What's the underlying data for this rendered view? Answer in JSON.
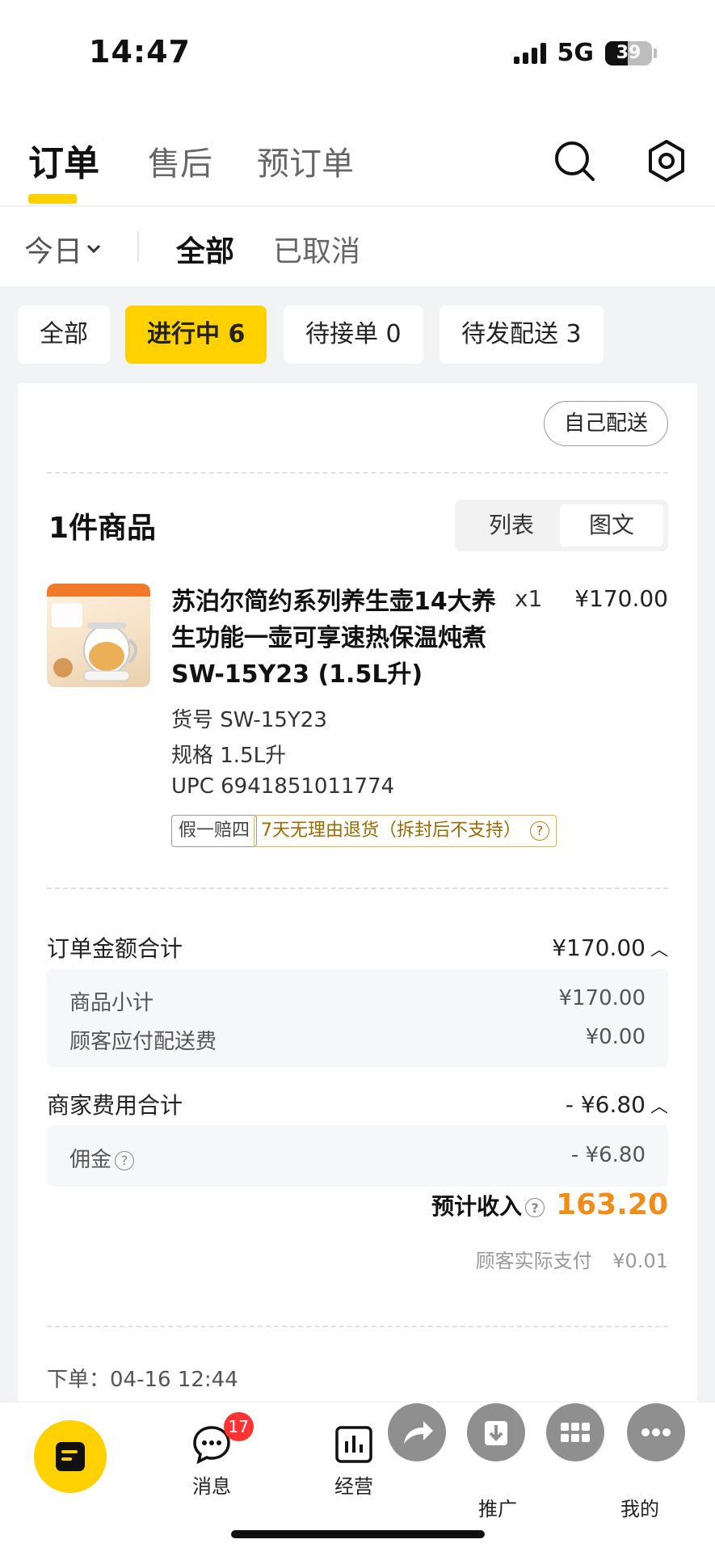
{
  "status_bar": {
    "time": "14:47",
    "network": "5G",
    "battery": "39"
  },
  "top_tabs": [
    "订单",
    "售后",
    "预订单"
  ],
  "filter": {
    "date": "今日",
    "segments": [
      "全部",
      "已取消"
    ]
  },
  "chips": [
    "全部",
    "进行中 6",
    "待接单 0",
    "待发配送 3"
  ],
  "card": {
    "self_delivery": "自己配送",
    "items_title": "1件商品",
    "view_toggle": [
      "列表",
      "图文"
    ],
    "product": {
      "name": "苏泊尔简约系列养生壶14大养生功能一壶可享速热保温炖煮SW-15Y23 (1.5L升)",
      "qty": "x1",
      "price": "¥170.00",
      "sku": "货号 SW-15Y23",
      "spec": "规格 1.5L升",
      "upc": "UPC 6941851011774",
      "tags": [
        "假一赔四",
        "7天无理由退货（拆封后不支持）"
      ]
    },
    "order_total": {
      "label": "订单金额合计",
      "value": "¥170.00"
    },
    "order_breakdown": [
      {
        "label": "商品小计",
        "value": "¥170.00"
      },
      {
        "label": "顾客应付配送费",
        "value": "¥0.00"
      }
    ],
    "merchant_fee": {
      "label": "商家费用合计",
      "value": "- ¥6.80"
    },
    "fee_breakdown": [
      {
        "label": "佣金",
        "value": "- ¥6.80"
      }
    ],
    "expected_income": {
      "label": "预计收入",
      "value": "163.20"
    },
    "customer_paid": {
      "label": "顾客实际支付",
      "value": "¥0.01"
    },
    "order_time": "下单：04-16 12:44"
  },
  "bottom_nav": {
    "messages": {
      "label": "消息",
      "badge": "17"
    },
    "business": "经营",
    "promotion": "推广",
    "mine": "我的"
  },
  "colors": {
    "accent": "#ffd100",
    "income": "#f08c1a",
    "badge": "#ff3333"
  }
}
